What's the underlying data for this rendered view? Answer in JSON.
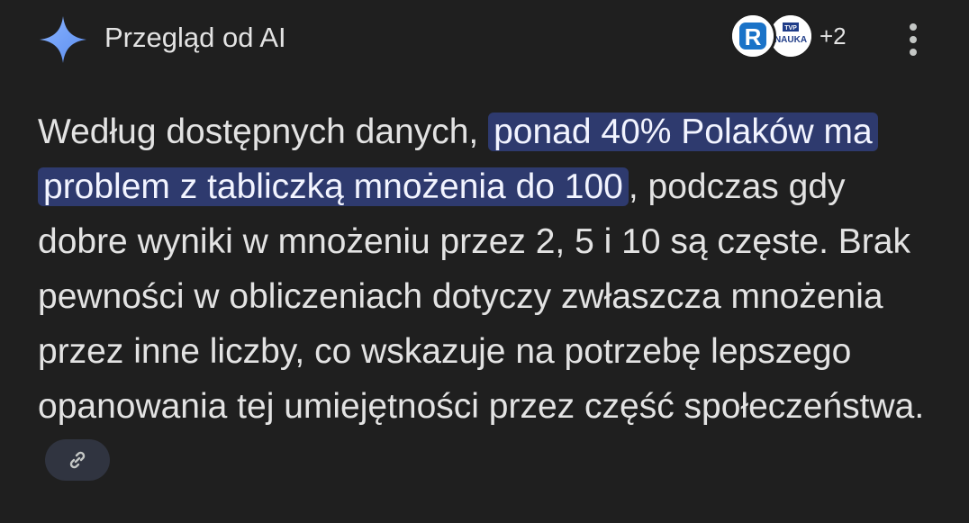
{
  "header": {
    "title": "Przegląd od AI",
    "sources_extra_count": "+2",
    "source_logos": [
      {
        "name": "R",
        "icon": "r-logo-icon"
      },
      {
        "name": "TVP NAUKA",
        "icon": "tvp-nauka-logo-icon"
      }
    ],
    "source_logo_texts": {
      "r": "R",
      "tvp_top": "TVP",
      "tvp_bottom": "NAUKA"
    }
  },
  "content": {
    "text_before": "Według dostępnych danych, ",
    "highlighted": "ponad 40% Polaków ma problem z tabliczką mnożenia do 100",
    "text_after": ", podczas gdy dobre wyniki w mnożeniu przez 2, 5 i 10 są częste. Brak pewności w obliczeniach dotyczy zwłaszcza mnożenia przez inne liczby, co wskazuje na potrzebę lepszego opanowania tej umiejętności przez część społeczeństwa."
  },
  "colors": {
    "background": "#1f1f1f",
    "text": "#e3e3e3",
    "highlight_bg": "#2e3a6e",
    "sparkle": "#6ea8fe",
    "link_button_bg": "#303440"
  },
  "icons": {
    "sparkle": "ai-sparkle-icon",
    "more": "more-vertical-icon",
    "link": "link-icon"
  }
}
